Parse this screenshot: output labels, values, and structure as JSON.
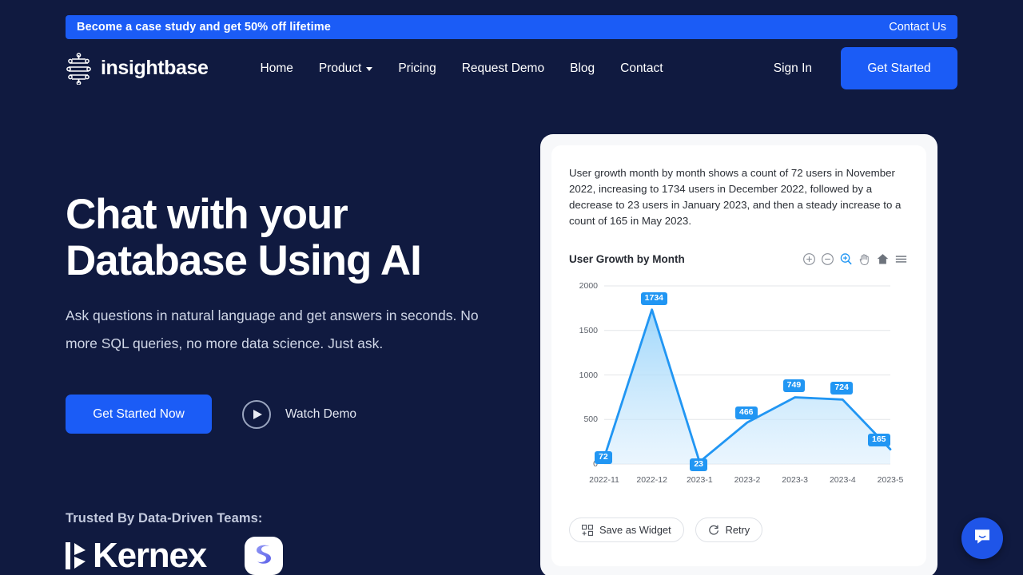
{
  "banner": {
    "message": "Become a case study and get 50% off lifetime",
    "cta": "Contact Us",
    "bg_color": "#1b5cf6"
  },
  "nav": {
    "brand": "insightbase",
    "brand_icon": "insightbase-logo-icon",
    "links": [
      {
        "label": "Home",
        "has_caret": false
      },
      {
        "label": "Product",
        "has_caret": true
      },
      {
        "label": "Pricing",
        "has_caret": false
      },
      {
        "label": "Request Demo",
        "has_caret": false
      },
      {
        "label": "Blog",
        "has_caret": false
      },
      {
        "label": "Contact",
        "has_caret": false
      }
    ],
    "sign_in": "Sign In",
    "get_started": "Get Started"
  },
  "hero": {
    "title_line1": "Chat with your",
    "title_line2": "Database Using AI",
    "subtitle": "Ask questions in natural language and get answers in seconds. No more SQL queries, no more data science. Just ask.",
    "primary_cta": "Get Started Now",
    "secondary_cta": "Watch Demo",
    "secondary_icon": "play-icon",
    "trusted_label": "Trusted By Data-Driven Teams:",
    "logos": [
      {
        "name": "Kernex",
        "icon": "kernex-logo-icon"
      },
      {
        "name": "Squared",
        "icon": "squared-logo-icon"
      }
    ]
  },
  "card": {
    "summary": "User growth month by month shows a count of 72 users in November 2022, increasing to 1734 users in December 2022, followed by a decrease to 23 users in January 2023, and then a steady increase to a count of 165 in May 2023.",
    "toolbar": [
      {
        "icon": "zoom-in-icon",
        "active": false
      },
      {
        "icon": "zoom-out-icon",
        "active": false
      },
      {
        "icon": "selection-zoom-icon",
        "active": true
      },
      {
        "icon": "panning-icon",
        "active": false
      },
      {
        "icon": "home-reset-icon",
        "active": false
      },
      {
        "icon": "menu-icon",
        "active": false
      }
    ],
    "actions": [
      {
        "label": "Save as Widget",
        "icon": "add-widget-icon"
      },
      {
        "label": "Retry",
        "icon": "refresh-icon"
      }
    ]
  },
  "messenger": {
    "icon": "chat-bubble-icon",
    "color": "#1f55e8"
  },
  "chart_data": {
    "type": "area",
    "title": "User Growth by Month",
    "xlabel": "",
    "ylabel": "",
    "categories": [
      "2022-11",
      "2022-12",
      "2023-1",
      "2023-2",
      "2023-3",
      "2023-4",
      "2023-5"
    ],
    "values": [
      72,
      1734,
      23,
      466,
      749,
      724,
      165
    ],
    "point_labels": [
      "72",
      "1734",
      "23",
      "466",
      "749",
      "724",
      "165"
    ],
    "yticks": [
      0,
      500,
      1000,
      1500,
      2000
    ],
    "ytick_labels": [
      "0",
      "500",
      "1000",
      "1500",
      "2000"
    ],
    "ylim": [
      0,
      2000
    ],
    "grid": true,
    "legend": "none",
    "line_color": "#2196f3",
    "fill_color": "#b9dffb",
    "label_bg": "#2196f3",
    "label_text_color": "#ffffff"
  }
}
